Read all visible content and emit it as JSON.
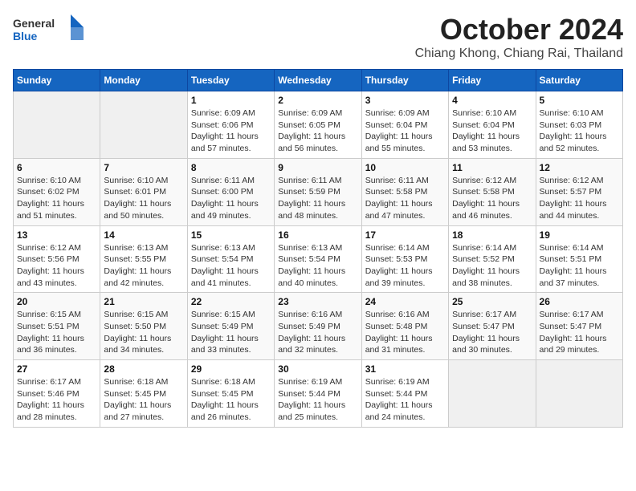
{
  "header": {
    "logo_general": "General",
    "logo_blue": "Blue",
    "title": "October 2024",
    "subtitle": "Chiang Khong, Chiang Rai, Thailand"
  },
  "columns": [
    "Sunday",
    "Monday",
    "Tuesday",
    "Wednesday",
    "Thursday",
    "Friday",
    "Saturday"
  ],
  "weeks": [
    [
      {
        "day": "",
        "sunrise": "",
        "sunset": "",
        "daylight": "",
        "empty": true
      },
      {
        "day": "",
        "sunrise": "",
        "sunset": "",
        "daylight": "",
        "empty": true
      },
      {
        "day": "1",
        "sunrise": "Sunrise: 6:09 AM",
        "sunset": "Sunset: 6:06 PM",
        "daylight": "Daylight: 11 hours and 57 minutes.",
        "empty": false
      },
      {
        "day": "2",
        "sunrise": "Sunrise: 6:09 AM",
        "sunset": "Sunset: 6:05 PM",
        "daylight": "Daylight: 11 hours and 56 minutes.",
        "empty": false
      },
      {
        "day": "3",
        "sunrise": "Sunrise: 6:09 AM",
        "sunset": "Sunset: 6:04 PM",
        "daylight": "Daylight: 11 hours and 55 minutes.",
        "empty": false
      },
      {
        "day": "4",
        "sunrise": "Sunrise: 6:10 AM",
        "sunset": "Sunset: 6:04 PM",
        "daylight": "Daylight: 11 hours and 53 minutes.",
        "empty": false
      },
      {
        "day": "5",
        "sunrise": "Sunrise: 6:10 AM",
        "sunset": "Sunset: 6:03 PM",
        "daylight": "Daylight: 11 hours and 52 minutes.",
        "empty": false
      }
    ],
    [
      {
        "day": "6",
        "sunrise": "Sunrise: 6:10 AM",
        "sunset": "Sunset: 6:02 PM",
        "daylight": "Daylight: 11 hours and 51 minutes.",
        "empty": false
      },
      {
        "day": "7",
        "sunrise": "Sunrise: 6:10 AM",
        "sunset": "Sunset: 6:01 PM",
        "daylight": "Daylight: 11 hours and 50 minutes.",
        "empty": false
      },
      {
        "day": "8",
        "sunrise": "Sunrise: 6:11 AM",
        "sunset": "Sunset: 6:00 PM",
        "daylight": "Daylight: 11 hours and 49 minutes.",
        "empty": false
      },
      {
        "day": "9",
        "sunrise": "Sunrise: 6:11 AM",
        "sunset": "Sunset: 5:59 PM",
        "daylight": "Daylight: 11 hours and 48 minutes.",
        "empty": false
      },
      {
        "day": "10",
        "sunrise": "Sunrise: 6:11 AM",
        "sunset": "Sunset: 5:58 PM",
        "daylight": "Daylight: 11 hours and 47 minutes.",
        "empty": false
      },
      {
        "day": "11",
        "sunrise": "Sunrise: 6:12 AM",
        "sunset": "Sunset: 5:58 PM",
        "daylight": "Daylight: 11 hours and 46 minutes.",
        "empty": false
      },
      {
        "day": "12",
        "sunrise": "Sunrise: 6:12 AM",
        "sunset": "Sunset: 5:57 PM",
        "daylight": "Daylight: 11 hours and 44 minutes.",
        "empty": false
      }
    ],
    [
      {
        "day": "13",
        "sunrise": "Sunrise: 6:12 AM",
        "sunset": "Sunset: 5:56 PM",
        "daylight": "Daylight: 11 hours and 43 minutes.",
        "empty": false
      },
      {
        "day": "14",
        "sunrise": "Sunrise: 6:13 AM",
        "sunset": "Sunset: 5:55 PM",
        "daylight": "Daylight: 11 hours and 42 minutes.",
        "empty": false
      },
      {
        "day": "15",
        "sunrise": "Sunrise: 6:13 AM",
        "sunset": "Sunset: 5:54 PM",
        "daylight": "Daylight: 11 hours and 41 minutes.",
        "empty": false
      },
      {
        "day": "16",
        "sunrise": "Sunrise: 6:13 AM",
        "sunset": "Sunset: 5:54 PM",
        "daylight": "Daylight: 11 hours and 40 minutes.",
        "empty": false
      },
      {
        "day": "17",
        "sunrise": "Sunrise: 6:14 AM",
        "sunset": "Sunset: 5:53 PM",
        "daylight": "Daylight: 11 hours and 39 minutes.",
        "empty": false
      },
      {
        "day": "18",
        "sunrise": "Sunrise: 6:14 AM",
        "sunset": "Sunset: 5:52 PM",
        "daylight": "Daylight: 11 hours and 38 minutes.",
        "empty": false
      },
      {
        "day": "19",
        "sunrise": "Sunrise: 6:14 AM",
        "sunset": "Sunset: 5:51 PM",
        "daylight": "Daylight: 11 hours and 37 minutes.",
        "empty": false
      }
    ],
    [
      {
        "day": "20",
        "sunrise": "Sunrise: 6:15 AM",
        "sunset": "Sunset: 5:51 PM",
        "daylight": "Daylight: 11 hours and 36 minutes.",
        "empty": false
      },
      {
        "day": "21",
        "sunrise": "Sunrise: 6:15 AM",
        "sunset": "Sunset: 5:50 PM",
        "daylight": "Daylight: 11 hours and 34 minutes.",
        "empty": false
      },
      {
        "day": "22",
        "sunrise": "Sunrise: 6:15 AM",
        "sunset": "Sunset: 5:49 PM",
        "daylight": "Daylight: 11 hours and 33 minutes.",
        "empty": false
      },
      {
        "day": "23",
        "sunrise": "Sunrise: 6:16 AM",
        "sunset": "Sunset: 5:49 PM",
        "daylight": "Daylight: 11 hours and 32 minutes.",
        "empty": false
      },
      {
        "day": "24",
        "sunrise": "Sunrise: 6:16 AM",
        "sunset": "Sunset: 5:48 PM",
        "daylight": "Daylight: 11 hours and 31 minutes.",
        "empty": false
      },
      {
        "day": "25",
        "sunrise": "Sunrise: 6:17 AM",
        "sunset": "Sunset: 5:47 PM",
        "daylight": "Daylight: 11 hours and 30 minutes.",
        "empty": false
      },
      {
        "day": "26",
        "sunrise": "Sunrise: 6:17 AM",
        "sunset": "Sunset: 5:47 PM",
        "daylight": "Daylight: 11 hours and 29 minutes.",
        "empty": false
      }
    ],
    [
      {
        "day": "27",
        "sunrise": "Sunrise: 6:17 AM",
        "sunset": "Sunset: 5:46 PM",
        "daylight": "Daylight: 11 hours and 28 minutes.",
        "empty": false
      },
      {
        "day": "28",
        "sunrise": "Sunrise: 6:18 AM",
        "sunset": "Sunset: 5:45 PM",
        "daylight": "Daylight: 11 hours and 27 minutes.",
        "empty": false
      },
      {
        "day": "29",
        "sunrise": "Sunrise: 6:18 AM",
        "sunset": "Sunset: 5:45 PM",
        "daylight": "Daylight: 11 hours and 26 minutes.",
        "empty": false
      },
      {
        "day": "30",
        "sunrise": "Sunrise: 6:19 AM",
        "sunset": "Sunset: 5:44 PM",
        "daylight": "Daylight: 11 hours and 25 minutes.",
        "empty": false
      },
      {
        "day": "31",
        "sunrise": "Sunrise: 6:19 AM",
        "sunset": "Sunset: 5:44 PM",
        "daylight": "Daylight: 11 hours and 24 minutes.",
        "empty": false
      },
      {
        "day": "",
        "sunrise": "",
        "sunset": "",
        "daylight": "",
        "empty": true
      },
      {
        "day": "",
        "sunrise": "",
        "sunset": "",
        "daylight": "",
        "empty": true
      }
    ]
  ]
}
